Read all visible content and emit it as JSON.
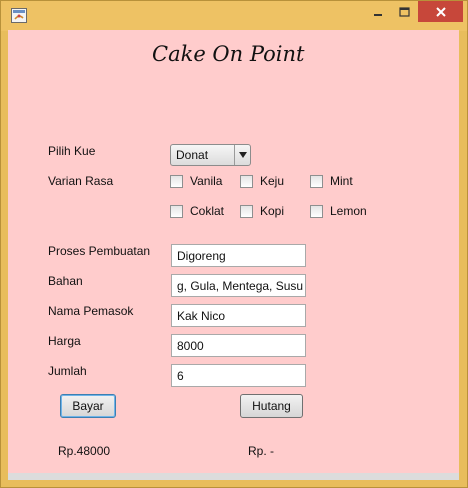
{
  "window": {
    "icon": "java-app-icon",
    "controls": {
      "minimize": "minimize-icon",
      "maximize": "maximize-icon",
      "close": "close-icon"
    }
  },
  "app": {
    "title": "Cake On Point"
  },
  "form": {
    "pilih_kue": {
      "label": "Pilih Kue",
      "selected": "Donat"
    },
    "varian_rasa": {
      "label": "Varian Rasa",
      "options": [
        {
          "label": "Vanila",
          "checked": false
        },
        {
          "label": "Keju",
          "checked": false
        },
        {
          "label": "Mint",
          "checked": false
        },
        {
          "label": "Coklat",
          "checked": false
        },
        {
          "label": "Kopi",
          "checked": false
        },
        {
          "label": "Lemon",
          "checked": false
        }
      ]
    },
    "proses": {
      "label": "Proses Pembuatan",
      "value": "Digoreng"
    },
    "bahan": {
      "label": "Bahan",
      "value": "g, Gula, Mentega, Susu"
    },
    "pemasok": {
      "label": "Nama Pemasok",
      "value": "Kak Nico"
    },
    "harga": {
      "label": "Harga",
      "value": "8000"
    },
    "jumlah": {
      "label": "Jumlah",
      "value": "6"
    }
  },
  "buttons": {
    "bayar": "Bayar",
    "hutang": "Hutang"
  },
  "results": {
    "bayar_total": "Rp.48000",
    "hutang_total": "Rp. -"
  }
}
